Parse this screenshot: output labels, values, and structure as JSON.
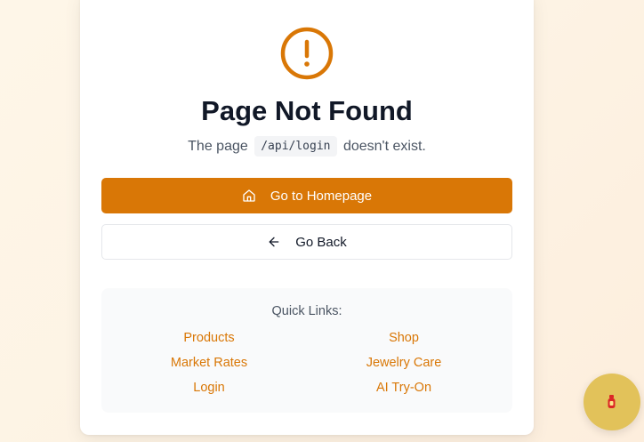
{
  "colors": {
    "accent": "#d97706",
    "fab": "#e2c25a",
    "title": "#111827"
  },
  "error": {
    "icon": "alert-circle-icon",
    "title": "Page Not Found",
    "message_prefix": "The page",
    "path": "/api/login",
    "message_suffix": "doesn't exist."
  },
  "actions": {
    "home": {
      "icon": "home-icon",
      "label": "Go to Homepage"
    },
    "back": {
      "icon": "arrow-left-icon",
      "label": "Go Back"
    }
  },
  "quick_links": {
    "title": "Quick Links:",
    "items": [
      {
        "label": "Products"
      },
      {
        "label": "Shop"
      },
      {
        "label": "Market Rates"
      },
      {
        "label": "Jewelry Care"
      },
      {
        "label": "Login"
      },
      {
        "label": "AI Try-On"
      }
    ]
  },
  "fab": {
    "icon": "bottle-icon"
  }
}
